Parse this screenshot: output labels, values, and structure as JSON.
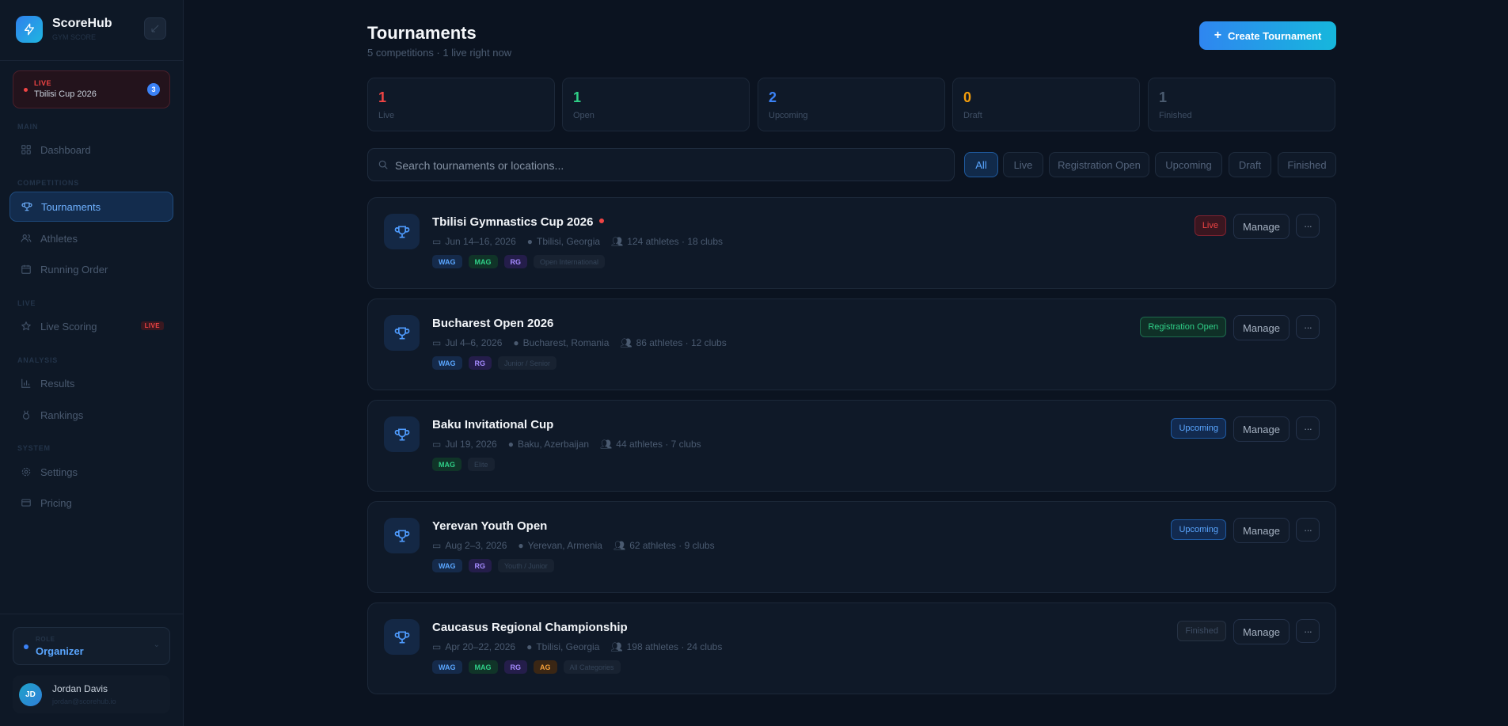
{
  "sidebar": {
    "brand": {
      "name": "ScoreHub",
      "subtitle": "GYM SCORE"
    },
    "live_card": {
      "tag": "LIVE",
      "name": "Tbilisi Cup 2026",
      "count": "3"
    },
    "sections": {
      "main": "MAIN",
      "competitions": "COMPETITIONS",
      "live": "LIVE",
      "analysis": "ANALYSIS",
      "system": "SYSTEM"
    },
    "nav": {
      "dashboard": "Dashboard",
      "tournaments": "Tournaments",
      "athletes": "Athletes",
      "running_order": "Running Order",
      "live_scoring": "Live Scoring",
      "live_badge": "LIVE",
      "results": "Results",
      "rankings": "Rankings",
      "settings": "Settings",
      "pricing": "Pricing"
    },
    "role": {
      "label": "ROLE",
      "value": "Organizer"
    },
    "user": {
      "initials": "JD",
      "name": "Jordan Davis",
      "email": "jordan@scorehub.io"
    }
  },
  "header": {
    "title": "Tournaments",
    "subtitle": "5 competitions · 1 live right now",
    "create_button": "Create Tournament"
  },
  "stats": [
    {
      "value": "1",
      "label": "Live",
      "color": "#ef4444"
    },
    {
      "value": "1",
      "label": "Open",
      "color": "#2fcf87"
    },
    {
      "value": "2",
      "label": "Upcoming",
      "color": "#3b82f6"
    },
    {
      "value": "0",
      "label": "Draft",
      "color": "#f59e0b"
    },
    {
      "value": "1",
      "label": "Finished",
      "color": "#4b5b70"
    }
  ],
  "search": {
    "placeholder": "Search tournaments or locations..."
  },
  "filters": [
    "All",
    "Live",
    "Registration Open",
    "Upcoming",
    "Draft",
    "Finished"
  ],
  "manage_label": "Manage",
  "more_label": "···",
  "tournaments": [
    {
      "name": "Tbilisi Gymnastics Cup 2026",
      "date": "Jun 14–16, 2026",
      "location": "Tbilisi, Georgia",
      "athletes": "124 athletes · 18 clubs",
      "tags": [
        "WAG",
        "MAG",
        "RG"
      ],
      "category": "Open International",
      "status": "Live"
    },
    {
      "name": "Bucharest Open 2026",
      "date": "Jul 4–6, 2026",
      "location": "Bucharest, Romania",
      "athletes": "86 athletes · 12 clubs",
      "tags": [
        "WAG",
        "RG"
      ],
      "category": "Junior / Senior",
      "status": "Registration Open"
    },
    {
      "name": "Baku Invitational Cup",
      "date": "Jul 19, 2026",
      "location": "Baku, Azerbaijan",
      "athletes": "44 athletes · 7 clubs",
      "tags": [
        "MAG"
      ],
      "category": "Elite",
      "status": "Upcoming"
    },
    {
      "name": "Yerevan Youth Open",
      "date": "Aug 2–3, 2026",
      "location": "Yerevan, Armenia",
      "athletes": "62 athletes · 9 clubs",
      "tags": [
        "WAG",
        "RG"
      ],
      "category": "Youth / Junior",
      "status": "Upcoming"
    },
    {
      "name": "Caucasus Regional Championship",
      "date": "Apr 20–22, 2026",
      "location": "Tbilisi, Georgia",
      "athletes": "198 athletes · 24 clubs",
      "tags": [
        "WAG",
        "MAG",
        "RG",
        "AG"
      ],
      "category": "All Categories",
      "status": "Finished"
    }
  ]
}
